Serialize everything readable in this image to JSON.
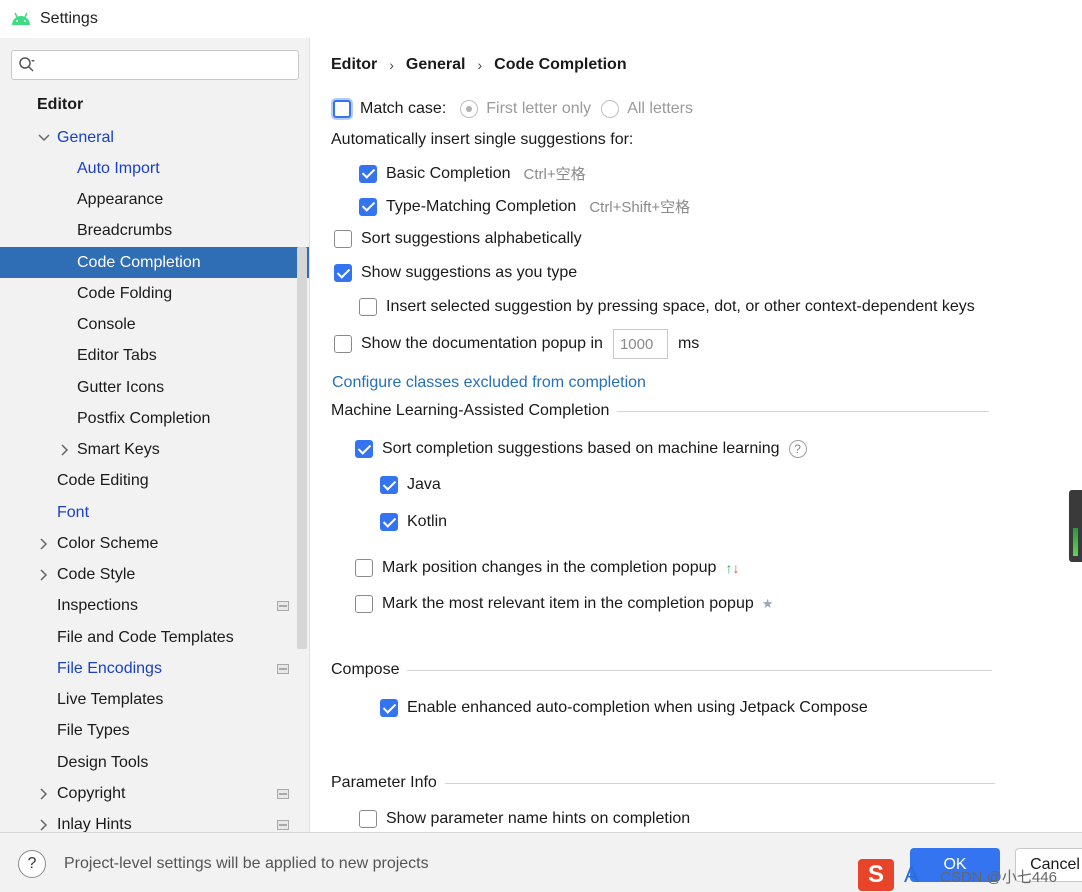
{
  "window": {
    "title": "Settings"
  },
  "sidebar": {
    "search_placeholder": "",
    "items": [
      {
        "label": "Editor"
      },
      {
        "label": "General"
      },
      {
        "label": "Auto Import"
      },
      {
        "label": "Appearance"
      },
      {
        "label": "Breadcrumbs"
      },
      {
        "label": "Code Completion"
      },
      {
        "label": "Code Folding"
      },
      {
        "label": "Console"
      },
      {
        "label": "Editor Tabs"
      },
      {
        "label": "Gutter Icons"
      },
      {
        "label": "Postfix Completion"
      },
      {
        "label": "Smart Keys"
      },
      {
        "label": "Code Editing"
      },
      {
        "label": "Font"
      },
      {
        "label": "Color Scheme"
      },
      {
        "label": "Code Style"
      },
      {
        "label": "Inspections"
      },
      {
        "label": "File and Code Templates"
      },
      {
        "label": "File Encodings"
      },
      {
        "label": "Live Templates"
      },
      {
        "label": "File Types"
      },
      {
        "label": "Design Tools"
      },
      {
        "label": "Copyright"
      },
      {
        "label": "Inlay Hints"
      }
    ]
  },
  "breadcrumb": [
    "Editor",
    "General",
    "Code Completion"
  ],
  "main": {
    "match_case": {
      "label": "Match case:",
      "checked": false
    },
    "first_letter_only": "First letter only",
    "all_letters": "All letters",
    "auto_insert_heading": "Automatically insert single suggestions for:",
    "basic_completion": {
      "label": "Basic Completion",
      "shortcut": "Ctrl+空格",
      "checked": true
    },
    "type_matching": {
      "label": "Type-Matching Completion",
      "shortcut": "Ctrl+Shift+空格",
      "checked": true
    },
    "sort_alpha": {
      "label": "Sort suggestions alphabetically",
      "checked": false
    },
    "show_as_type": {
      "label": "Show suggestions as you type",
      "checked": true
    },
    "insert_selected": {
      "label": "Insert selected suggestion by pressing space, dot, or other context-dependent keys",
      "checked": false
    },
    "doc_popup": {
      "label": "Show the documentation popup in",
      "value": "1000",
      "unit": "ms",
      "checked": false
    },
    "configure_link": "Configure classes excluded from completion",
    "ml_section": "Machine Learning-Assisted Completion",
    "ml_sort": {
      "label": "Sort completion suggestions based on machine learning",
      "checked": true
    },
    "ml_java": {
      "label": "Java",
      "checked": true
    },
    "ml_kotlin": {
      "label": "Kotlin",
      "checked": true
    },
    "mark_position": {
      "label": "Mark position changes in the completion popup",
      "checked": false
    },
    "mark_relevant": {
      "label": "Mark the most relevant item in the completion popup",
      "checked": false
    },
    "compose_section": "Compose",
    "compose_enhanced": {
      "label": "Enable enhanced auto-completion when using Jetpack Compose",
      "checked": true
    },
    "param_section": "Parameter Info",
    "param_hints": {
      "label": "Show parameter name hints on completion",
      "checked": false
    }
  },
  "footer": {
    "help": "?",
    "message": "Project-level settings will be applied to new projects",
    "ok": "OK",
    "cancel": "Cancel"
  },
  "overlay": {
    "ime_logo": "S",
    "ime_a": "A",
    "watermark": "CSDN @小七446"
  }
}
